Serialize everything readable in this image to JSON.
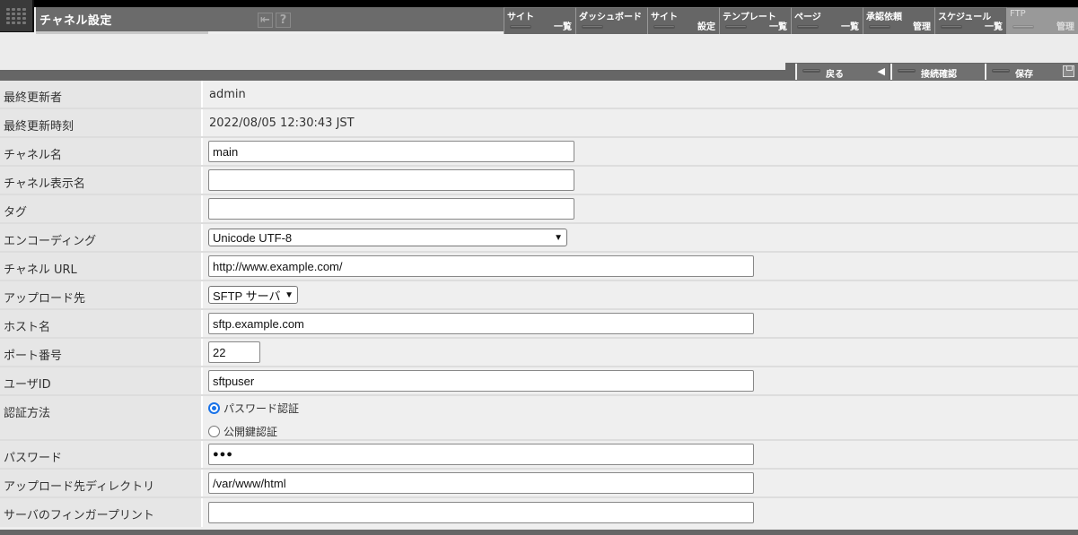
{
  "header": {
    "title": "チャネル設定",
    "icons": [
      {
        "name": "logout-icon",
        "glyph": "⇤"
      },
      {
        "name": "help-icon",
        "glyph": "?"
      }
    ]
  },
  "nav": [
    {
      "top": "サイト",
      "bottom": "一覧"
    },
    {
      "top": "ダッシュボード",
      "bottom": ""
    },
    {
      "top": "サイト",
      "bottom": "設定"
    },
    {
      "top": "テンプレート",
      "bottom": "一覧"
    },
    {
      "top": "ページ",
      "bottom": "一覧"
    },
    {
      "top": "承認依頼",
      "bottom": "管理"
    },
    {
      "top": "スケジュール",
      "bottom": "一覧"
    },
    {
      "top": "FTP",
      "bottom": "管理",
      "active": true
    }
  ],
  "toolbar": {
    "back_label": "戻る",
    "back_icon": "◀",
    "test_label": "接続確認",
    "save_label": "保存"
  },
  "form": {
    "last_updated_by": {
      "label": "最終更新者",
      "value": "admin"
    },
    "last_updated_at": {
      "label": "最終更新時刻",
      "value": "2022/08/05 12:30:43 JST"
    },
    "channel_name": {
      "label": "チャネル名",
      "value": "main"
    },
    "channel_display_name": {
      "label": "チャネル表示名",
      "value": ""
    },
    "tag": {
      "label": "タグ",
      "value": ""
    },
    "encoding": {
      "label": "エンコーディング",
      "value": "Unicode UTF-8"
    },
    "channel_url": {
      "label": "チャネル URL",
      "value": "http://www.example.com/"
    },
    "upload_target": {
      "label": "アップロード先",
      "value": "SFTP サーバ"
    },
    "host": {
      "label": "ホスト名",
      "value": "sftp.example.com"
    },
    "port": {
      "label": "ポート番号",
      "value": "22"
    },
    "user_id": {
      "label": "ユーザID",
      "value": "sftpuser"
    },
    "auth_method": {
      "label": "認証方法",
      "options": [
        {
          "label": "パスワード認証",
          "selected": true
        },
        {
          "label": "公開鍵認証",
          "selected": false
        }
      ]
    },
    "password": {
      "label": "パスワード",
      "value": "●●●"
    },
    "upload_dir": {
      "label": "アップロード先ディレクトリ",
      "value": "/var/www/html"
    },
    "fingerprint": {
      "label": "サーバのフィンガープリント",
      "value": ""
    }
  },
  "colors": {
    "header_bg": "#6b6b6b",
    "nav_active": "#999999",
    "radio_accent": "#1a73e8"
  }
}
